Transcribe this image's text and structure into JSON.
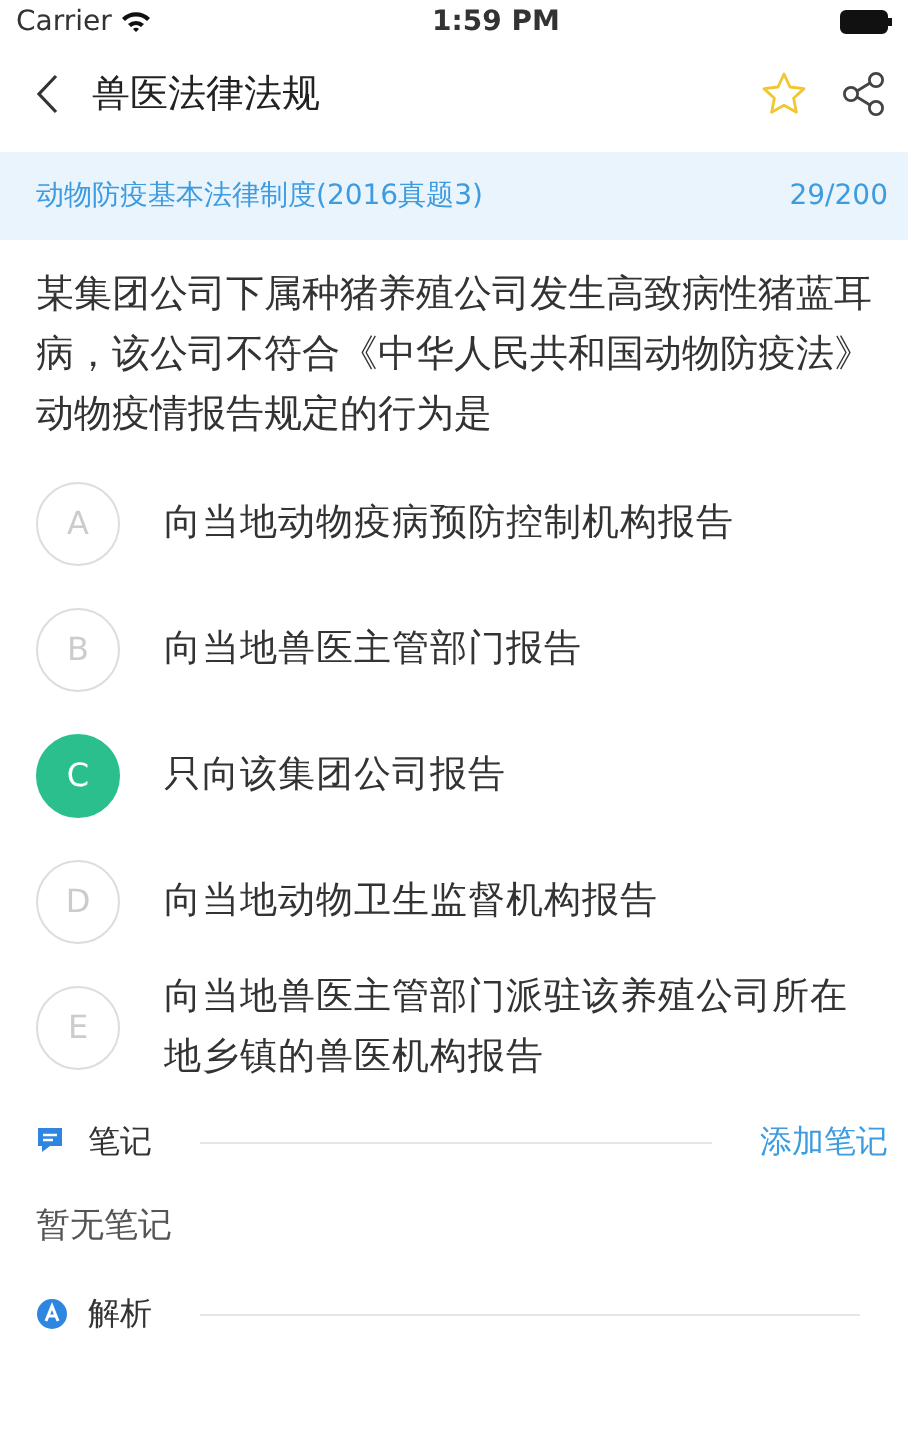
{
  "status_bar": {
    "carrier": "Carrier",
    "time": "1:59 PM"
  },
  "nav": {
    "title": "兽医法律法规",
    "favorited": false
  },
  "category": {
    "name": "动物防疫基本法律制度(2016真题3)",
    "progress": "29/200"
  },
  "question": "某集团公司下属种猪养殖公司发生高致病性猪蓝耳病，该公司不符合《中华人民共和国动物防疫法》动物疫情报告规定的行为是",
  "options": [
    {
      "letter": "A",
      "text": "向当地动物疫病预防控制机构报告",
      "selected": false
    },
    {
      "letter": "B",
      "text": "向当地兽医主管部门报告",
      "selected": false
    },
    {
      "letter": "C",
      "text": "只向该集团公司报告",
      "selected": true
    },
    {
      "letter": "D",
      "text": "向当地动物卫生监督机构报告",
      "selected": false
    },
    {
      "letter": "E",
      "text": "向当地兽医主管部门派驻该养殖公司所在地乡镇的兽医机构报告",
      "selected": false
    }
  ],
  "notes": {
    "title": "笔记",
    "add_label": "添加笔记",
    "empty_text": "暂无笔记"
  },
  "analysis": {
    "title": "解析"
  }
}
